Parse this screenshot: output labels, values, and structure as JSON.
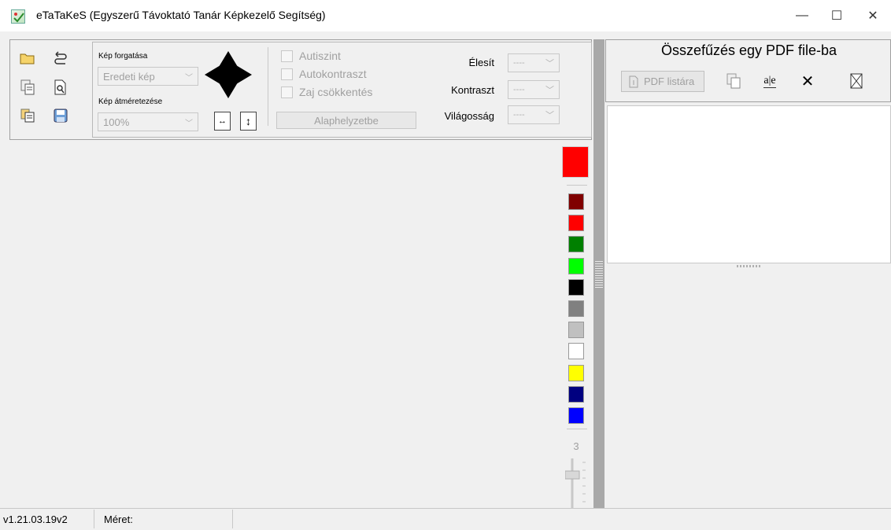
{
  "window": {
    "title": "eTaTaKeS (Egyszerű Távoktató Tanár Képkezelő Segítség)",
    "minimize": "—",
    "maximize": "☐",
    "close": "✕"
  },
  "toolbar": {
    "rotate_label": "Kép forgatása",
    "rotate_value": "Eredeti kép",
    "resize_label": "Kép átméretezése",
    "resize_value": "100%",
    "autolevel": "Autiszint",
    "autocontrast": "Autokontraszt",
    "denoise": "Zaj csökkentés",
    "reset": "Alaphelyzetbe",
    "sharpen_label": "Élesít",
    "contrast_label": "Kontraszt",
    "brightness_label": "Világosság",
    "dash_value": "----"
  },
  "pdf_panel": {
    "title": "Összefűzés egy PDF file-ba",
    "list_button": "PDF listára"
  },
  "palette": {
    "current": "#ff0000",
    "swatches": [
      "#800000",
      "#ff0000",
      "#008000",
      "#00ff00",
      "#000000",
      "#808080",
      "#c0c0c0",
      "#ffffff",
      "#ffff00",
      "#000080",
      "#0000ff"
    ],
    "pen_size": "3"
  },
  "status": {
    "version": "v1.21.03.19v2",
    "size_label": "Méret:"
  },
  "icons": [
    "open-folder-icon",
    "undo-icon",
    "copy-image-icon",
    "print-preview-icon",
    "paste-icon",
    "save-icon",
    "rotate-arrows-icon",
    "fit-width-icon",
    "fit-height-icon",
    "pdf-add-icon",
    "ocr-icon",
    "delete-icon",
    "clear-list-icon"
  ]
}
